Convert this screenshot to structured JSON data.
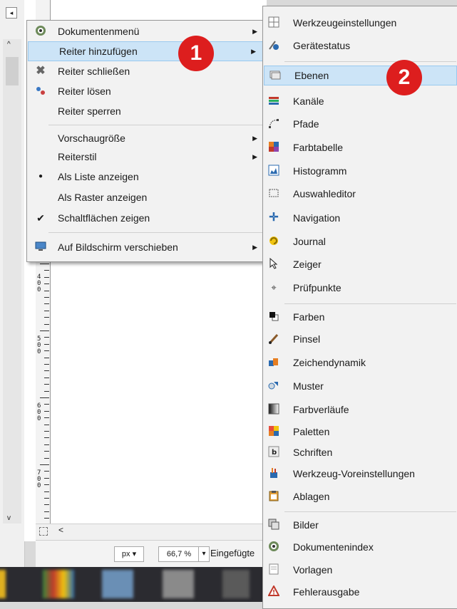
{
  "background": {
    "ruler_labels": [
      "400",
      "500",
      "600",
      "700"
    ],
    "unit": "px",
    "zoom": "66,7 %",
    "status_text": "Eingefügte"
  },
  "menu1": {
    "items": [
      {
        "label": "Dokumentenmenü",
        "icon": "gimp-wilber-icon",
        "submenu": true
      },
      {
        "label": "Reiter hinzufügen",
        "icon": "",
        "submenu": true,
        "highlighted": true
      },
      {
        "label": "Reiter schließen",
        "icon": "close-x-icon"
      },
      {
        "label": "Reiter lösen",
        "icon": "detach-icon"
      },
      {
        "label": "Reiter sperren",
        "icon": ""
      },
      {
        "label": "Vorschaugröße",
        "icon": "",
        "submenu": true
      },
      {
        "label": "Reiterstil",
        "icon": "",
        "submenu": true
      },
      {
        "label": "Als Liste anzeigen",
        "icon": "bullet-icon"
      },
      {
        "label": "Als Raster anzeigen",
        "icon": ""
      },
      {
        "label": "Schaltflächen zeigen",
        "icon": "checkmark-icon"
      },
      {
        "label": "Auf Bildschirm verschieben",
        "icon": "monitor-icon",
        "submenu": true
      }
    ]
  },
  "menu2": {
    "items": [
      {
        "label": "Werkzeugeinstellungen",
        "icon": "tool-options-icon"
      },
      {
        "label": "Gerätestatus",
        "icon": "device-status-icon"
      },
      {
        "label": "Ebenen",
        "icon": "layers-icon",
        "highlighted": true
      },
      {
        "label": "Kanäle",
        "icon": "channels-icon"
      },
      {
        "label": "Pfade",
        "icon": "paths-icon"
      },
      {
        "label": "Farbtabelle",
        "icon": "colormap-icon"
      },
      {
        "label": "Histogramm",
        "icon": "histogram-icon"
      },
      {
        "label": "Auswahleditor",
        "icon": "selection-editor-icon"
      },
      {
        "label": "Navigation",
        "icon": "navigation-icon"
      },
      {
        "label": "Journal",
        "icon": "undo-history-icon"
      },
      {
        "label": "Zeiger",
        "icon": "pointer-icon"
      },
      {
        "label": "Prüfpunkte",
        "icon": "sample-points-icon"
      },
      {
        "label": "Farben",
        "icon": "colors-icon"
      },
      {
        "label": "Pinsel",
        "icon": "brush-icon"
      },
      {
        "label": "Zeichendynamik",
        "icon": "paint-dynamics-icon"
      },
      {
        "label": "Muster",
        "icon": "patterns-icon"
      },
      {
        "label": "Farbverläufe",
        "icon": "gradients-icon"
      },
      {
        "label": "Paletten",
        "icon": "palettes-icon"
      },
      {
        "label": "Schriften",
        "icon": "fonts-icon"
      },
      {
        "label": "Werkzeug-Voreinstellungen",
        "icon": "tool-presets-icon"
      },
      {
        "label": "Ablagen",
        "icon": "buffers-icon"
      },
      {
        "label": "Bilder",
        "icon": "images-icon"
      },
      {
        "label": "Dokumentenindex",
        "icon": "document-history-icon"
      },
      {
        "label": "Vorlagen",
        "icon": "templates-icon"
      },
      {
        "label": "Fehlerausgabe",
        "icon": "error-console-icon"
      }
    ]
  },
  "badges": [
    "1",
    "2"
  ],
  "colors": {
    "highlight": "#cce4f7",
    "badge": "#dd1e1e",
    "menu_bg": "#f2f2f2"
  }
}
